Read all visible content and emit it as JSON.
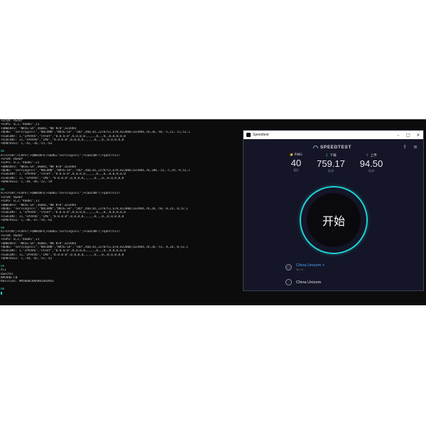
{
  "terminal": {
    "lines": [
      {
        "text": "+CPIN: READY",
        "type": "normal"
      },
      {
        "text": "+COPS: 0,2,\"46001\",11",
        "type": "normal"
      },
      {
        "text": "+QNWINFO: \"NR5G-SA\",46001,\"NR N78\",633984",
        "type": "normal"
      },
      {
        "text": "+QENG: \"servingcell\",\"NOCONN\",\"NR5G-SA\",\"TDD\",460,01,2278751,678,82200B,633984,78,20,-44,-5,23,-11,52,1",
        "type": "normal"
      },
      {
        "text": "+CGDCONT: 1,\"IPV4V6\",\"ctnet\",\"0.0.0.0\",0,0,0,0,,,,,,0,,,0,,0,0,0,0,0",
        "type": "normal"
      },
      {
        "text": "+CGDCONT: 11,\"IPV4V6\",\"IMS\",\"0.0.0.0\",0,0,0,0,,,,,,0,,,0,,0,0,0,0,0",
        "type": "normal"
      },
      {
        "text": "+QANTRSSI: 1,-42,-38,-55,-63",
        "type": "normal"
      },
      {
        "text": "",
        "type": "normal"
      },
      {
        "text": "OK",
        "type": "ok"
      },
      {
        "text": "AT+CPIN?;+COPS?;+QNWINFO;+QENG=\"servingcell\";+CGDCONT?;+qantrssi?",
        "type": "normal"
      },
      {
        "text": "+CPIN: READY",
        "type": "normal"
      },
      {
        "text": "+COPS: 0,2,\"46001\",11",
        "type": "normal"
      },
      {
        "text": "+QNWINFO: \"NR5G-SA\",46001,\"NR N78\",633984",
        "type": "normal"
      },
      {
        "text": "+QENG: \"servingcell\",\"NOCONN\",\"NR5G-SA\",\"TDD\",460,01,2278751,678,82200B,633984,78,100,-52,-5,29,-9,52,1",
        "type": "normal"
      },
      {
        "text": "+CGDCONT: 1,\"IPV4V6\",\"ctnet\",\"0.0.0.0\",0,0,0,0,,,,,,0,,,0,,0,0,0,0,0",
        "type": "normal"
      },
      {
        "text": "+CGDCONT: 11,\"IPV4V6\",\"IMS\",\"0.0.0.0\",0,0,0,0,,,,,,0,,,0,,0,0,0,0,0",
        "type": "normal"
      },
      {
        "text": "+QANTRSSI: 1,-49,-49,-52,-59",
        "type": "normal"
      },
      {
        "text": "",
        "type": "normal"
      },
      {
        "text": "OK",
        "type": "ok"
      },
      {
        "text": "AT+CPIN?;+COPS?;+QNWINFO;+QENG=\"servingcell\";+CGDCONT?;+qantrssi?",
        "type": "normal"
      },
      {
        "text": "+CPIN: READY",
        "type": "normal"
      },
      {
        "text": "+COPS: 0,2,\"46001\",11",
        "type": "normal"
      },
      {
        "text": "+QNWINFO: \"NR5G-SA\",46001,\"NR N78\",633984",
        "type": "normal"
      },
      {
        "text": "+QENG: \"servingcell\",\"NOCONN\",\"NR5G-SA\",\"TDD\",460,01,2278751,678,82200B,633984,78,20,-50,-8,24,-8,52,1",
        "type": "normal"
      },
      {
        "text": "+CGDCONT: 1,\"IPV4V6\",\"ctnet\",\"0.0.0.0\",0,0,0,0,,,,,,0,,,0,,0,0,0,0,0",
        "type": "normal"
      },
      {
        "text": "+CGDCONT: 11,\"IPV4V6\",\"IMS\",\"0.0.0.0\",0,0,0,0,,,,,,0,,,0,,0,0,0,0,0",
        "type": "normal"
      },
      {
        "text": "+QANTRSSI: 1,-48,-47,-56,-62",
        "type": "normal"
      },
      {
        "text": "",
        "type": "normal"
      },
      {
        "text": "OK",
        "type": "ok"
      },
      {
        "text": "AT+CPIN?;+COPS?;+QNWINFO;+QENG=\"servingcell\";+CGDCONT?;+qantrssi?",
        "type": "normal"
      },
      {
        "text": "+CPIN: READY",
        "type": "normal"
      },
      {
        "text": "+COPS: 0,2,\"46001\",11",
        "type": "normal"
      },
      {
        "text": "+QNWINFO: \"NR5G-SA\",46001,\"NR N78\",633984",
        "type": "normal"
      },
      {
        "text": "+QENG: \"servingcell\",\"NOCONN\",\"NR5G-SA\",\"TDD\",460,01,2278751,678,82200B,633984,78,20,-51,-4,26,-8,52,1",
        "type": "normal"
      },
      {
        "text": "+CGDCONT: 1,\"IPV4V6\",\"ctnet\",\"0.0.0.0\",0,0,0,0,,,,,,0,,,0,,0,0,0,0,0",
        "type": "normal"
      },
      {
        "text": "+CGDCONT: 11,\"IPV4V6\",\"IMS\",\"0.0.0.0\",0,0,0,0,,,,,,0,,,0,,0,0,0,0,0",
        "type": "normal"
      },
      {
        "text": "+QANTRSSI: 1,-44,-45,-51,-61",
        "type": "normal"
      },
      {
        "text": "",
        "type": "normal"
      },
      {
        "text": "OK",
        "type": "ok"
      },
      {
        "text": "ATI",
        "type": "normal"
      },
      {
        "text": "Quectel",
        "type": "normal"
      },
      {
        "text": "RM500U-CN",
        "type": "normal"
      },
      {
        "text": "Revision: RM500UCNAAR01A05M2G",
        "type": "normal"
      },
      {
        "text": "",
        "type": "normal"
      },
      {
        "text": "OK",
        "type": "ok"
      }
    ]
  },
  "speedtest": {
    "window_title": "Speedtest",
    "brand": "SPEEDTEST",
    "ping": {
      "label": "PING",
      "value": "40",
      "unit": "毫秒"
    },
    "download": {
      "label": "下载",
      "value": "759.17",
      "unit": "兆/秒"
    },
    "upload": {
      "label": "上传",
      "value": "94.50",
      "unit": "兆/秒"
    },
    "go_label": "开始",
    "isp": {
      "name": "China Unicom",
      "chevron": ">",
      "sub": "Wu Xi"
    },
    "server": {
      "name": "China Unicom"
    },
    "colors": {
      "accent": "#1fd1d3",
      "ping": "#ffcc33",
      "download": "#2fe1d4",
      "upload": "#b77dff",
      "link": "#4aa8ff"
    }
  }
}
